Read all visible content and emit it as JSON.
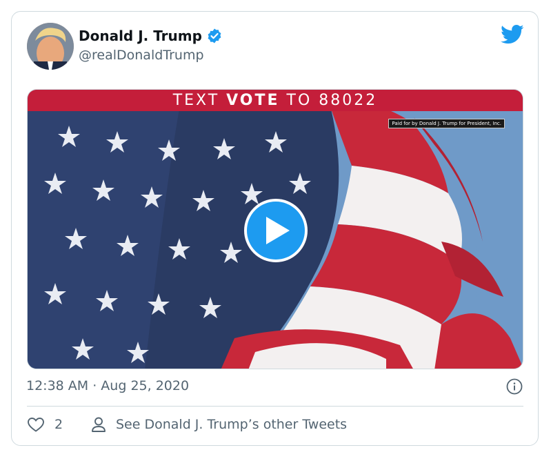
{
  "tweet": {
    "author_name": "Donald J. Trump",
    "handle": "@realDonaldTrump",
    "timestamp": "12:38 AM · Aug 25, 2020",
    "like_count": "2",
    "other_tweets_label": "See Donald J. Trump’s other Tweets"
  },
  "media": {
    "banner_prefix": "TEXT ",
    "banner_bold": "VOTE",
    "banner_suffix": " TO 88022",
    "disclaimer": "Paid for by Donald J. Trump for President, Inc."
  },
  "icons": {
    "verified": "verified-badge-icon",
    "brand": "twitter-bird-icon",
    "play": "play-icon",
    "info": "info-icon",
    "like": "heart-icon",
    "profile": "person-icon"
  },
  "colors": {
    "accent": "#1d9bf0",
    "text_primary": "#0f1419",
    "text_secondary": "#536471",
    "banner_red": "#c41e3a"
  }
}
